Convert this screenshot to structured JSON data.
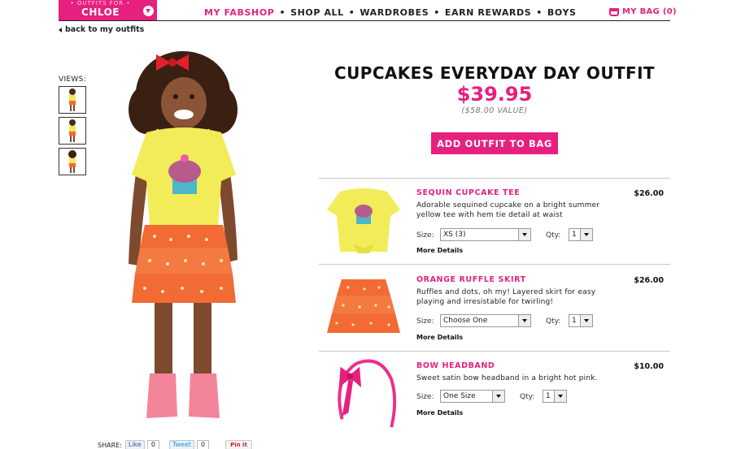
{
  "header": {
    "outfit_for_label": "• OUTFITS FOR •",
    "outfit_for_name": "CHLOE",
    "nav": [
      "MY FABSHOP",
      "SHOP ALL",
      "WARDROBES",
      "EARN REWARDS",
      "BOYS"
    ],
    "nav_separator": "•",
    "bag_label": "MY BAG (0)",
    "accent": "#e6207f"
  },
  "back_link": "back to my outfits",
  "views_label": "VIEWS:",
  "outfit": {
    "title": "CUPCAKES EVERYDAY DAY OUTFIT",
    "price": "$39.95",
    "value": "($58.00 VALUE)",
    "add_button": "ADD OUTFIT TO BAG"
  },
  "items": [
    {
      "name": "SEQUIN CUPCAKE TEE",
      "price": "$26.00",
      "description": "Adorable sequined cupcake on a bright summer yellow tee with hem tie detail at waist",
      "size_label": "Size:",
      "size_value": "XS (3)",
      "qty_label": "Qty:",
      "qty_value": "1",
      "more": "More Details"
    },
    {
      "name": "ORANGE RUFFLE SKIRT",
      "price": "$26.00",
      "description": "Ruffles and dots, oh my! Layered skirt for easy playing and irresistable for twirling!",
      "size_label": "Size:",
      "size_value": "Choose One",
      "qty_label": "Qty:",
      "qty_value": "1",
      "more": "More Details"
    },
    {
      "name": "BOW HEADBAND",
      "price": "$10.00",
      "description": "Sweet satin bow headband in a bright hot pink.",
      "size_label": "Size:",
      "size_value": "One Size",
      "qty_label": "Qty:",
      "qty_value": "1",
      "more": "More Details"
    }
  ],
  "share": {
    "label": "SHARE:",
    "like": "Like",
    "like_count": "0",
    "tweet": "Tweet",
    "tweet_count": "0",
    "pin": "Pin it"
  }
}
